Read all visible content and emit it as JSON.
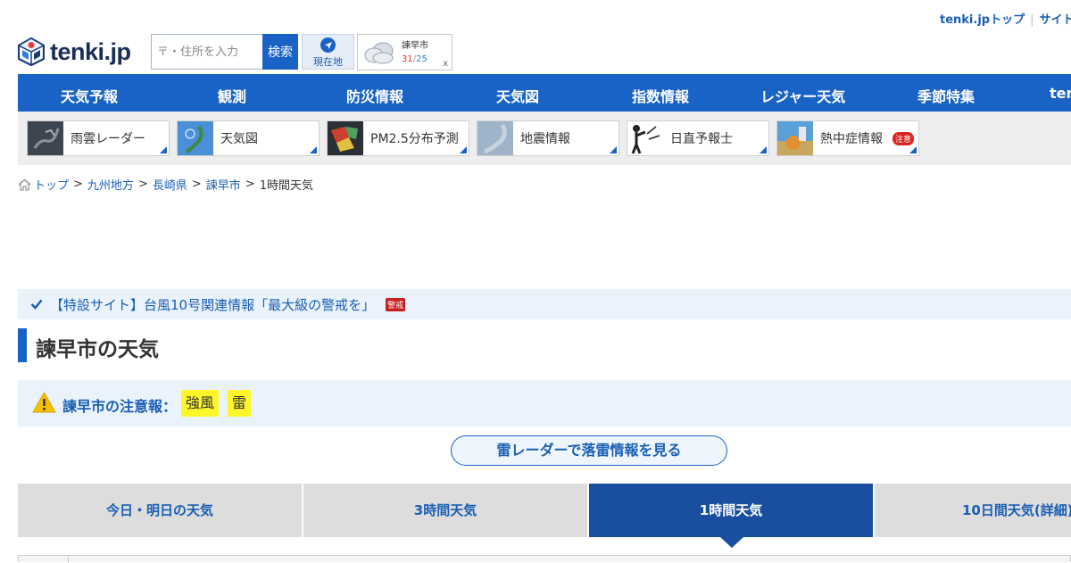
{
  "top_links": {
    "home": "tenki.jpトップ",
    "site": "サイト"
  },
  "logo": {
    "text": "tenki.jp"
  },
  "search": {
    "placeholder": "〒・住所を入力",
    "button": "検索"
  },
  "current_location": {
    "label": "現在地"
  },
  "mini_weather": {
    "city": "諫早市",
    "high": "31",
    "slash": "/",
    "low": "25",
    "close": "x"
  },
  "nav": {
    "items": [
      "天気予報",
      "観測",
      "防災情報",
      "天気図",
      "指数情報",
      "レジャー天気",
      "季節特集",
      "ten"
    ]
  },
  "subnav": {
    "items": [
      {
        "label": "雨雲レーダー",
        "icon": "rain-radar-thumbnail"
      },
      {
        "label": "天気図",
        "icon": "weather-map-thumbnail"
      },
      {
        "label": "PM2.5分布予測",
        "icon": "pm25-thumbnail"
      },
      {
        "label": "地震情報",
        "icon": "earthquake-thumbnail"
      },
      {
        "label": "日直予報士",
        "icon": "forecaster-thumbnail"
      },
      {
        "label": "熱中症情報",
        "icon": "heatstroke-thumbnail",
        "badge": "注意"
      }
    ]
  },
  "breadcrumb": {
    "items": [
      "トップ",
      "九州地方",
      "長崎県",
      "諫早市"
    ],
    "current": "1時間天気",
    "separator": ">"
  },
  "special": {
    "text": "【特設サイト】台風10号関連情報「最大級の警戒を」",
    "badge": "警戒"
  },
  "page_title": "諫早市の天気",
  "warning": {
    "label": "諫早市の注意報：",
    "items": [
      "強風",
      "雷"
    ]
  },
  "radar_button": "雷レーダーで落雷情報を見る",
  "tabs": {
    "items": [
      "今日・明日の天気",
      "3時間天気",
      "1時間天気",
      "10日間天気(詳細)"
    ],
    "active": "1時間天気"
  },
  "colors": {
    "brand_blue": "#1a63c6",
    "active_tab": "#1a4fa0",
    "warning_chip": "#fff629",
    "alert_red": "#c81e1e"
  }
}
